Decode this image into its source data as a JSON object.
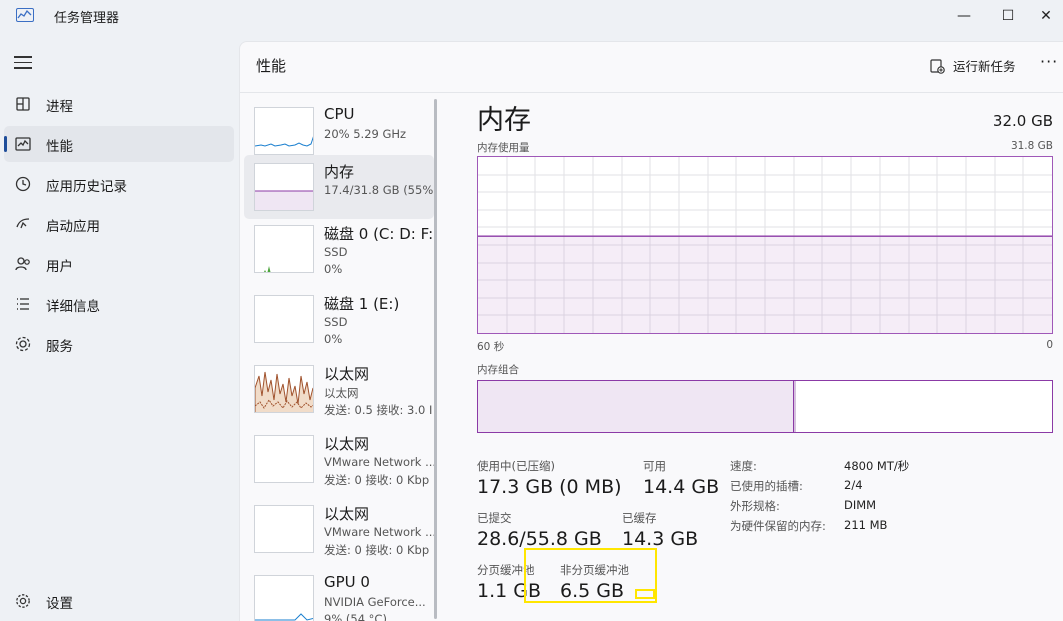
{
  "app": {
    "title": "任务管理器",
    "icon": "task-manager-icon"
  },
  "window_controls": {
    "minimize": "—",
    "maximize": "☐",
    "close": "✕"
  },
  "nav": {
    "items": [
      {
        "label": "进程",
        "icon": "processes-icon"
      },
      {
        "label": "性能",
        "icon": "performance-icon",
        "active": true
      },
      {
        "label": "应用历史记录",
        "icon": "history-icon"
      },
      {
        "label": "启动应用",
        "icon": "startup-icon"
      },
      {
        "label": "用户",
        "icon": "users-icon"
      },
      {
        "label": "详细信息",
        "icon": "details-icon"
      },
      {
        "label": "服务",
        "icon": "services-icon"
      }
    ],
    "settings_label": "设置"
  },
  "header": {
    "title": "性能",
    "run_task_label": "运行新任务",
    "more_label": "···"
  },
  "devices": [
    {
      "name": "CPU",
      "sub1": "20%  5.29 GHz",
      "sub2": ""
    },
    {
      "name": "内存",
      "sub1": "17.4/31.8 GB (55%)",
      "sub2": ""
    },
    {
      "name": "磁盘 0 (C: D: F:",
      "sub1": "SSD",
      "sub2": "0%"
    },
    {
      "name": "磁盘 1 (E:)",
      "sub1": "SSD",
      "sub2": "0%"
    },
    {
      "name": "以太网",
      "sub1": "以太网",
      "sub2": "发送: 0.5  接收: 3.0 I"
    },
    {
      "name": "以太网",
      "sub1": "VMware Network ...",
      "sub2": "发送: 0  接收: 0 Kbp"
    },
    {
      "name": "以太网",
      "sub1": "VMware Network ...",
      "sub2": "发送: 0  接收: 0 Kbp"
    },
    {
      "name": "GPU 0",
      "sub1": "NVIDIA GeForce...",
      "sub2": "9% (54 °C)"
    }
  ],
  "detail": {
    "title": "内存",
    "total": "32.0 GB",
    "usage_label": "内存使用量",
    "usage_max": "31.8 GB",
    "time_left": "60 秒",
    "time_right": "0",
    "composition_label": "内存组合",
    "usage_fraction": 0.55,
    "composition_used_fraction": 0.55,
    "stats": {
      "in_use_label": "使用中(已压缩)",
      "in_use_value": "17.3 GB (0 MB)",
      "available_label": "可用",
      "available_value": "14.4 GB",
      "committed_label": "已提交",
      "committed_value": "28.6/55.8 GB",
      "cached_label": "已缓存",
      "cached_value": "14.3 GB",
      "paged_label": "分页缓冲池",
      "paged_value": "1.1 GB",
      "nonpaged_label": "非分页缓冲池",
      "nonpaged_value": "6.5 GB"
    },
    "props": [
      {
        "label": "速度:",
        "value": "4800 MT/秒"
      },
      {
        "label": "已使用的插槽:",
        "value": "2/4"
      },
      {
        "label": "外形规格:",
        "value": "DIMM"
      },
      {
        "label": "为硬件保留的内存:",
        "value": "211 MB"
      }
    ]
  },
  "colors": {
    "memory": "#8b3aa6",
    "cpu": "#1a7fcf",
    "disk": "#4aa43a",
    "ethernet": "#a0522d",
    "highlight": "#ffe600"
  }
}
